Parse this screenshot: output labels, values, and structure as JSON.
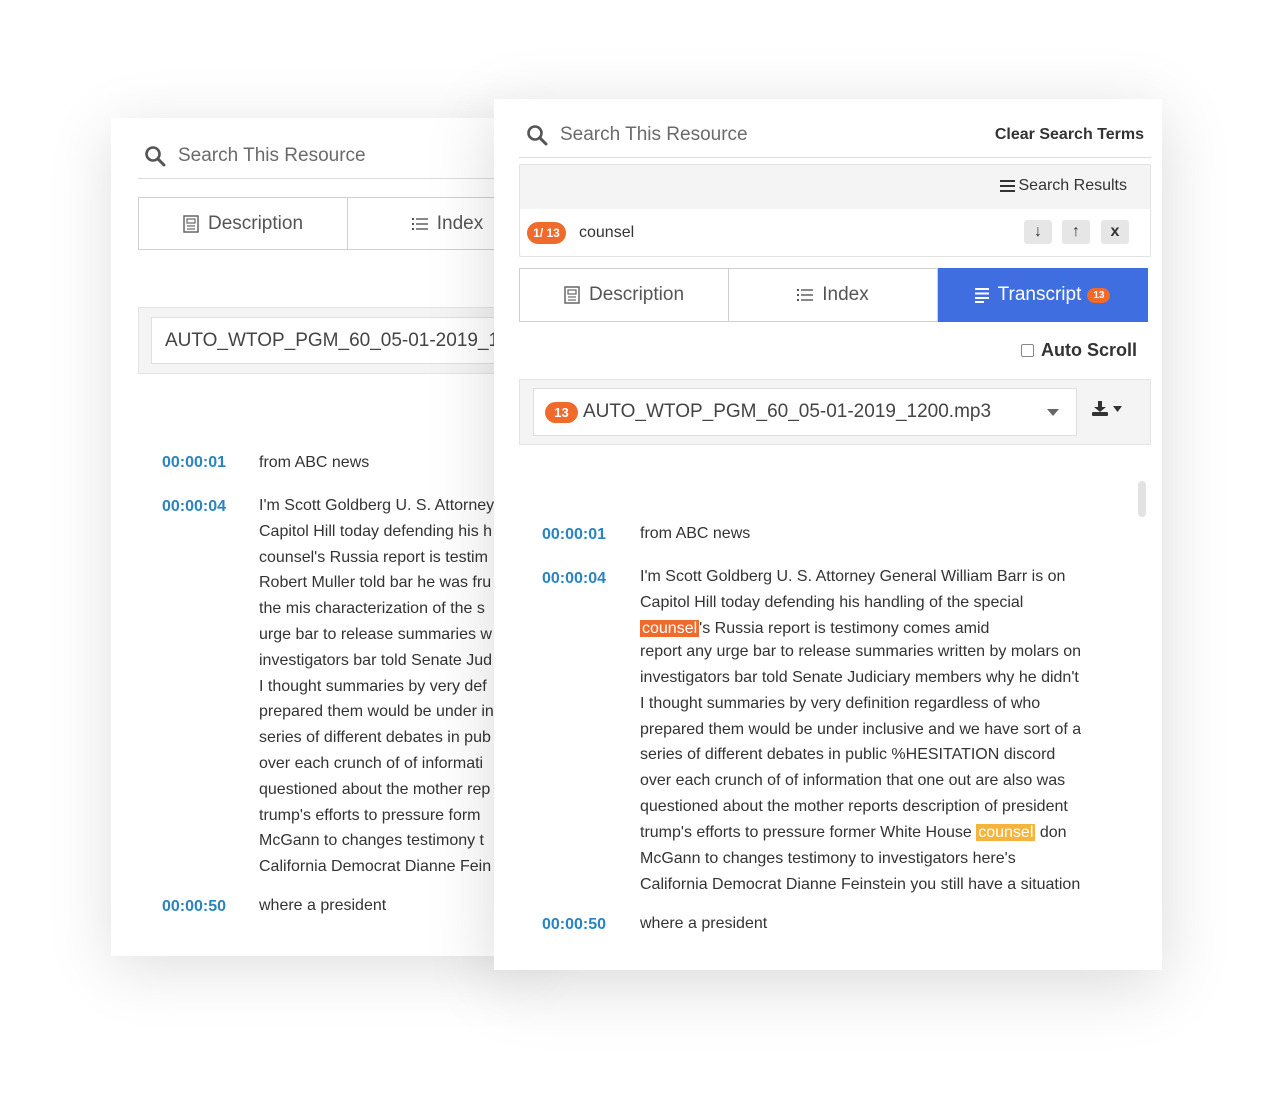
{
  "search": {
    "placeholder": "Search This Resource",
    "clear_label": "Clear Search Terms"
  },
  "results": {
    "header_label": "Search Results",
    "position_badge": "1/ 13",
    "term": "counsel",
    "down_label": "↓",
    "up_label": "↑",
    "close_label": "x"
  },
  "tabs": {
    "description": "Description",
    "index": "Index",
    "transcript": "Transcript",
    "transcript_count": "13"
  },
  "auto_scroll": {
    "label": "Auto Scroll",
    "checked": false
  },
  "file": {
    "name": "AUTO_WTOP_PGM_60_05-01-2019_1200.mp3",
    "name_truncated": "AUTO_WTOP_PGM_60_05-01-2019_1200",
    "count": "13"
  },
  "transcript": [
    {
      "time": "00:00:01",
      "lines": [
        "from ABC news"
      ]
    },
    {
      "time": "00:00:04",
      "lines": [
        "I'm Scott Goldberg U. S. Attorney General William Barr is on",
        "Capitol Hill today defending his handling of the special",
        "counsel's Russia report is testimony comes amid",
        "report any urge bar to release summaries written by molars on",
        "investigators bar told Senate Judiciary members why he didn't",
        "I thought summaries by very definition regardless of who",
        "prepared them would be under inclusive and we have sort of a",
        "series of different debates in public %HESITATION discord",
        "over each crunch of of information that one out are also was",
        "questioned about the mother reports description of president",
        "trump's efforts to pressure former White House counsel don",
        "McGann to changes testimony to investigators here's",
        "California Democrat Dianne Feinstein you still have a situation"
      ]
    },
    {
      "time": "00:00:50",
      "lines": [
        "where a president"
      ]
    }
  ],
  "back_panel": {
    "lines_04": [
      "I'm Scott Goldberg U. S. Attorney",
      "Capitol Hill today defending his h",
      "counsel's Russia report is testim",
      "Robert Muller told bar he was fru",
      "the mis characterization of the s",
      "urge bar to release summaries w",
      "investigators bar told Senate Jud",
      "I thought summaries by very def",
      "prepared them would be under in",
      "series of different debates in pub",
      "over each crunch of of informati",
      "questioned about the mother rep",
      "trump's efforts to pressure form",
      "McGann to changes testimony t",
      "California Democrat Dianne Fein"
    ]
  },
  "front_panel": {
    "hl_prefix": "counsel",
    "hl_suffix": "'s Russia report is testimony comes amid",
    "line11_before": "trump's efforts to pressure former White House ",
    "line11_hl": "counsel",
    "line11_after": " don"
  },
  "colors": {
    "accent": "#3f6ee0",
    "badge": "#f06a2b",
    "highlight": "#f5b53c",
    "timestamp": "#2b84c0"
  },
  "icons": [
    "search-icon",
    "description-icon",
    "index-list-icon",
    "transcript-icon",
    "hamburger-icon",
    "download-icon",
    "caret-down-icon"
  ]
}
